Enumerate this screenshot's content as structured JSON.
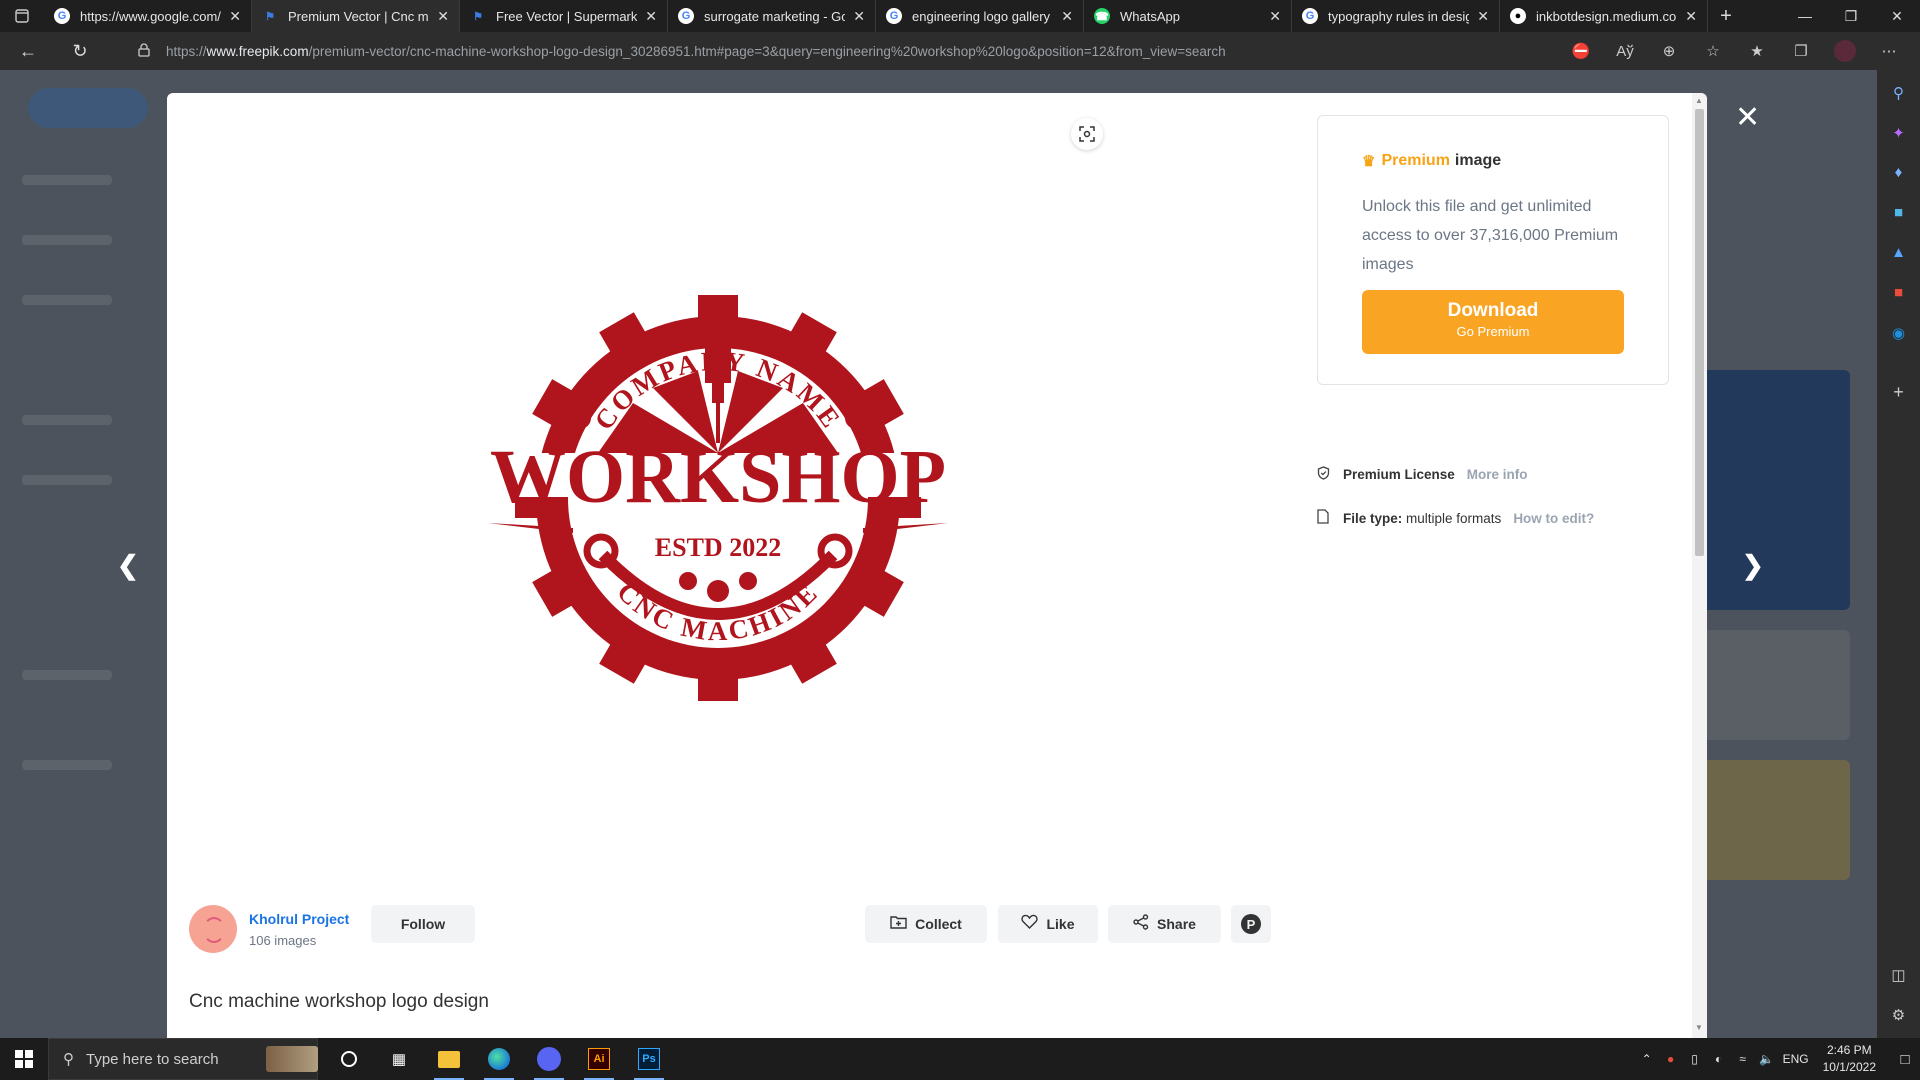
{
  "browser": {
    "tabs": [
      {
        "title": "https://www.google.com/s",
        "favicon": "google",
        "active": false
      },
      {
        "title": "Premium Vector | Cnc mac",
        "favicon": "freepik",
        "active": true
      },
      {
        "title": "Free Vector | Supermarket",
        "favicon": "freepik",
        "active": false
      },
      {
        "title": "surrogate marketing - Goo",
        "favicon": "google",
        "active": false
      },
      {
        "title": "engineering logo gallery -",
        "favicon": "google",
        "active": false
      },
      {
        "title": "WhatsApp",
        "favicon": "whatsapp",
        "active": false
      },
      {
        "title": "typography rules in design",
        "favicon": "google",
        "active": false
      },
      {
        "title": "inkbotdesign.medium.com",
        "favicon": "medium",
        "active": false
      }
    ],
    "url_prefix": "https://",
    "url_domain": "www.freepik.com",
    "url_path": "/premium-vector/cnc-machine-workshop-logo-design_30286951.htm#page=3&query=engineering%20workshop%20logo&position=12&from_view=search"
  },
  "modal": {
    "premium_word": "Premium",
    "premium_suffix": "image",
    "premium_desc": "Unlock this file and get unlimited access to over 37,316,000 Premium images",
    "download_label": "Download",
    "download_sub": "Go Premium",
    "license_label": "Premium License",
    "license_link": "More info",
    "filetype_label": "File type:",
    "filetype_value": "multiple formats",
    "filetype_link": "How to edit?",
    "author_name": "Kholrul Project",
    "author_count": "106 images",
    "follow_label": "Follow",
    "collect_label": "Collect",
    "like_label": "Like",
    "share_label": "Share",
    "image_title": "Cnc machine workshop logo design",
    "logo": {
      "top_text": "COMPANY NAME",
      "main_text": "WORKSHOP",
      "estd_text": "ESTD 2022",
      "bottom_text": "CNC MACHINE",
      "color": "#b0141c"
    }
  },
  "taskbar": {
    "search_placeholder": "Type here to search",
    "lang": "ENG",
    "time": "2:46 PM",
    "date": "10/1/2022"
  },
  "colors": {
    "accent_orange": "#faa423",
    "link_blue": "#1b74e4"
  }
}
